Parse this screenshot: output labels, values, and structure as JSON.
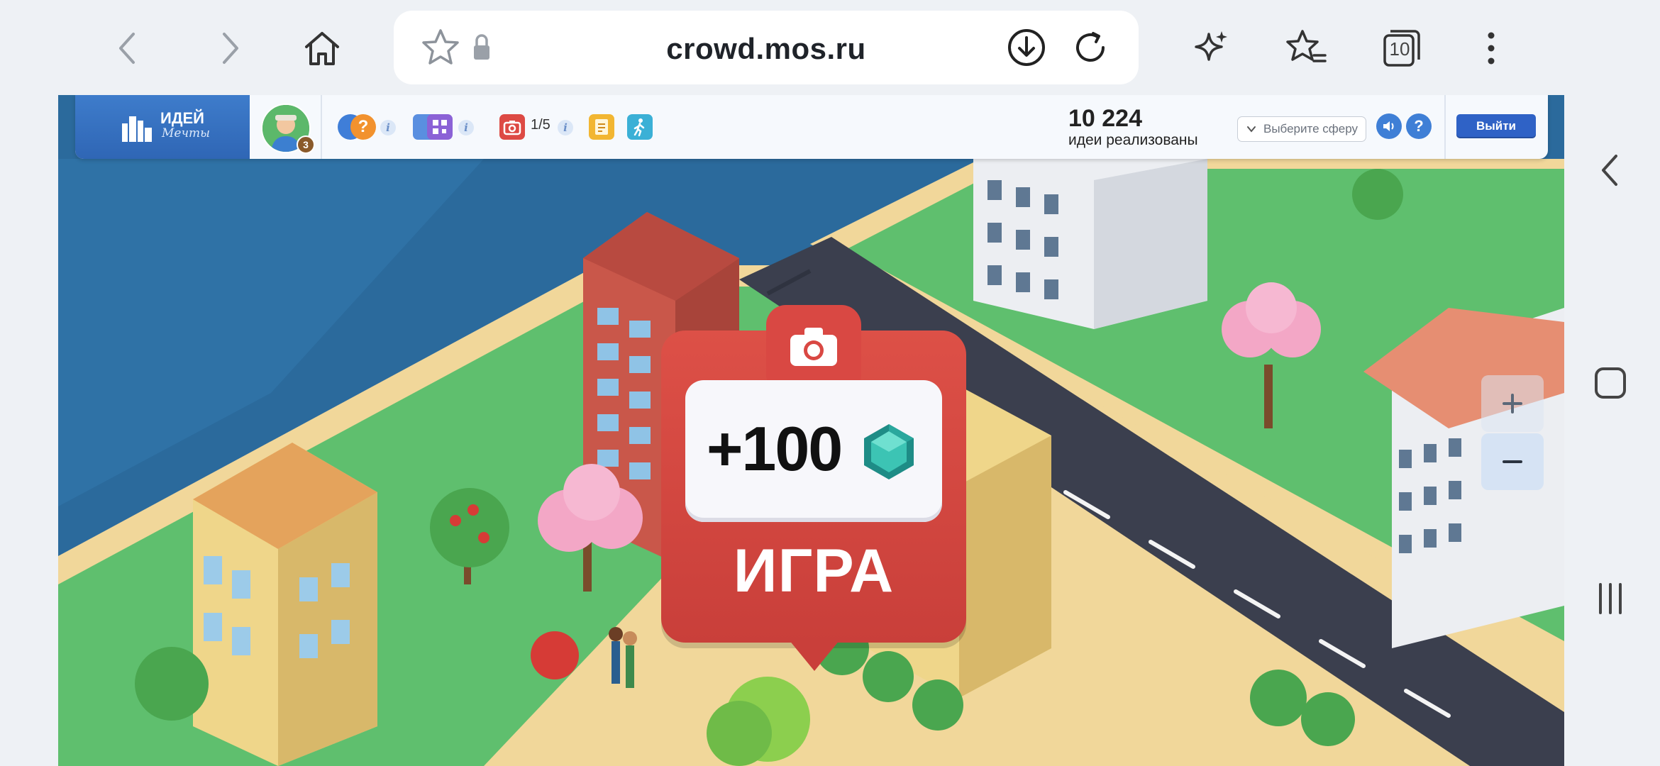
{
  "browser": {
    "url": "crowd.mos.ru",
    "tabs_count": "10",
    "icons": [
      "back-icon",
      "forward-icon",
      "home-icon",
      "bookmark-star-icon",
      "lock-icon",
      "download-icon",
      "reload-icon",
      "sparkle-icon",
      "bookmarks-list-icon",
      "tabs-icon",
      "more-icon"
    ]
  },
  "header": {
    "logo_main": "ИДЕЙ",
    "logo_sub": "Мечты",
    "avatar_level": "3",
    "counter": "1/5",
    "ideas_count": "10 224",
    "ideas_label": "идеи реализованы",
    "sphere_placeholder": "Выберите сферу",
    "help_label": "?",
    "exit_label": "Выйти"
  },
  "marker": {
    "amount": "+100",
    "label": "ИГРА"
  },
  "zoom": {
    "plus": "+",
    "minus": "−"
  },
  "colors": {
    "water": "#2b6a9c",
    "grass": "#5fbf6e",
    "road": "#3b3f4e",
    "marker_red": "#d94843",
    "header_bg": "#f6f9fd",
    "accent_blue": "#2f62c6"
  }
}
